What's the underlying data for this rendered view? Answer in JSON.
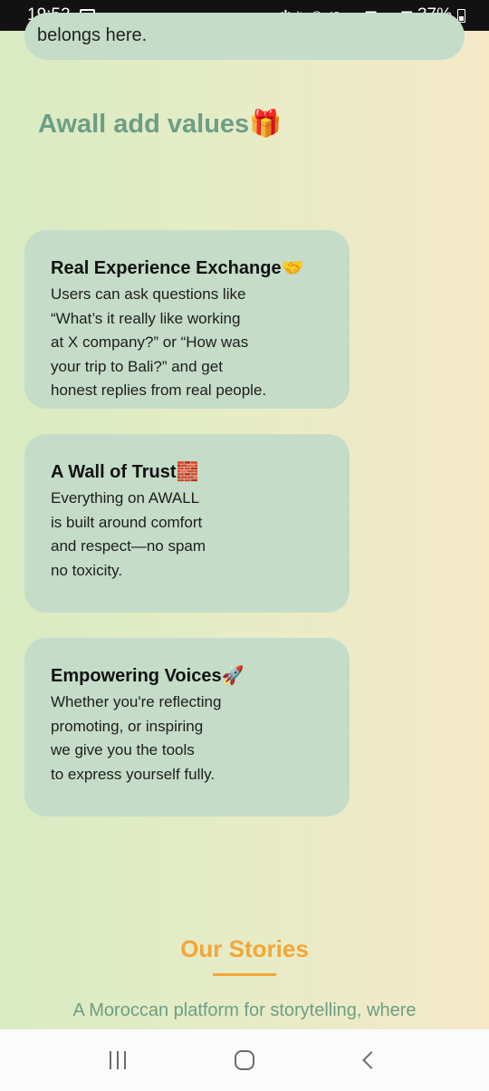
{
  "status_bar": {
    "time": "19:52",
    "network": "4G",
    "battery": "37%"
  },
  "top_card": {
    "text": "belongs here."
  },
  "values_section": {
    "title": "Awall add values🎁",
    "cards": [
      {
        "title": "Real Experience Exchange🤝",
        "body": "Users can ask questions like\n“What’s it really like working\nat X company?” or “How was\nyour trip to Bali?” and get\nhonest replies from real people."
      },
      {
        "title": "A Wall of Trust🧱",
        "body": "Everything on AWALL\nis built around comfort\nand respect—no spam\nno toxicity."
      },
      {
        "title": "Empowering Voices🚀",
        "body": "Whether you're reflecting\npromoting, or inspiring\nwe give you the tools\nto express yourself fully."
      }
    ]
  },
  "stories_section": {
    "title": "Our Stories",
    "description": "A Moroccan platform for storytelling, where"
  }
}
